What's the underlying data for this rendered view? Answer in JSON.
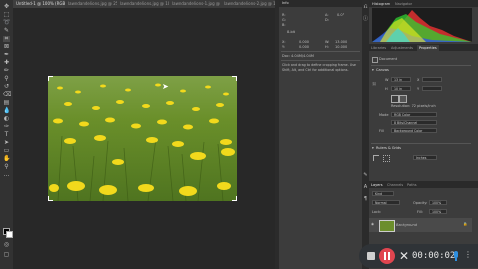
{
  "tabs": [
    {
      "label": "Untitled-1 @ 100% (RGB/8)"
    },
    {
      "label": "lawndandelions.jpg @ 25% (RGB/8)"
    },
    {
      "label": "lawndandelions.jpg @ 100% (RGB/8)"
    },
    {
      "label": "lawndandelions-1.jpg @ 100% (RGB/8)"
    },
    {
      "label": "lawndandelions-2.jpg @ 100% (RGB/8)"
    }
  ],
  "info_panel": {
    "title": "Info",
    "rgb_r": "R:",
    "rgb_g": "G:",
    "rgb_b": "B:",
    "bit": "8-bit",
    "angle_label": "A:",
    "angle_value": "0.0°",
    "d_label": "D:",
    "x_label": "X:",
    "y_label": "Y:",
    "x_value": "0.000",
    "y_value": "0.000",
    "w_label": "W:",
    "h_label": "H:",
    "w_value": "13.000",
    "h_value": "10.000",
    "doc": "Doc: 4.04M/4.04M",
    "hint": "Click and drag to define cropping frame. Use Shift, Alt, and Ctrl for additional options."
  },
  "histogram_tabs": [
    "Histogram",
    "Navigator"
  ],
  "mid_tabs": [
    "Libraries",
    "Adjustments",
    "Properties"
  ],
  "properties": {
    "document_label": "Document",
    "canvas_section": "Canvas",
    "w_label": "W",
    "w_value": "13 in",
    "h_label": "H",
    "h_value": "10 in",
    "x_label": "X",
    "y_label": "Y",
    "resolution": "Resolution: 72 pixels/inch",
    "mode_label": "Mode",
    "mode_value": "RGB Color",
    "depth_value": "8 Bits/Channel",
    "fill_label": "Fill",
    "fill_value": "Background Color",
    "rulers_section": "Rulers & Grids",
    "units_value": "Inches"
  },
  "layers": {
    "tabs": [
      "Layers",
      "Channels",
      "Paths"
    ],
    "kind_label": "Kind",
    "mode_value": "Normal",
    "opacity_label": "Opacity:",
    "opacity_value": "100%",
    "lock_label": "Lock:",
    "fill_label": "Fill:",
    "fill_value": "100%",
    "layer_name": "Background"
  },
  "recorder": {
    "time": "00:00:02"
  },
  "colors": {
    "record_red": "#e0454f",
    "accent_blue": "#2e8fe0",
    "panel_bg": "#3c3c3c"
  }
}
